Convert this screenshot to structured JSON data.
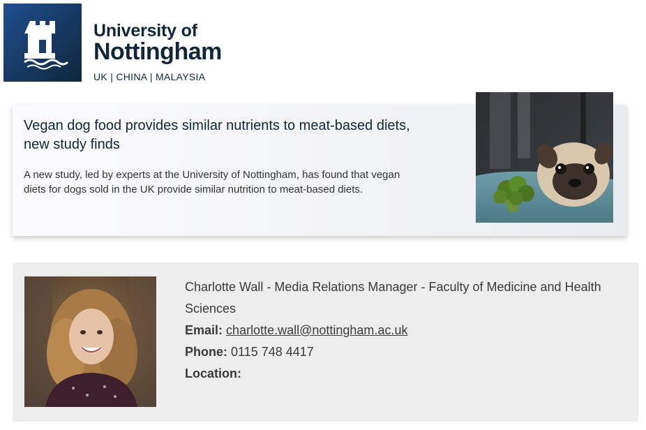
{
  "header": {
    "logo": {
      "line1": "University of",
      "line2": "Nottingham",
      "line3": "UK | CHINA | MALAYSIA"
    }
  },
  "news": {
    "title": "Vegan dog food provides similar nutrients to meat-based diets, new study finds",
    "summary": "A new study, led by experts at the University of Nottingham, has found that vegan diets for dogs sold in the UK provide similar nutrition to meat-based diets."
  },
  "contact": {
    "name_role": "Charlotte Wall - Media Relations Manager - Faculty of Medicine and Health Sciences",
    "email_label": "Email:",
    "email": "charlotte.wall@nottingham.ac.uk",
    "phone_label": "Phone:",
    "phone": "0115 748 4417",
    "location_label": "Location:"
  },
  "colors": {
    "brand_navy": "#10263b",
    "brand_blue": "#1e4f8f",
    "contact_bg": "#ededed"
  }
}
